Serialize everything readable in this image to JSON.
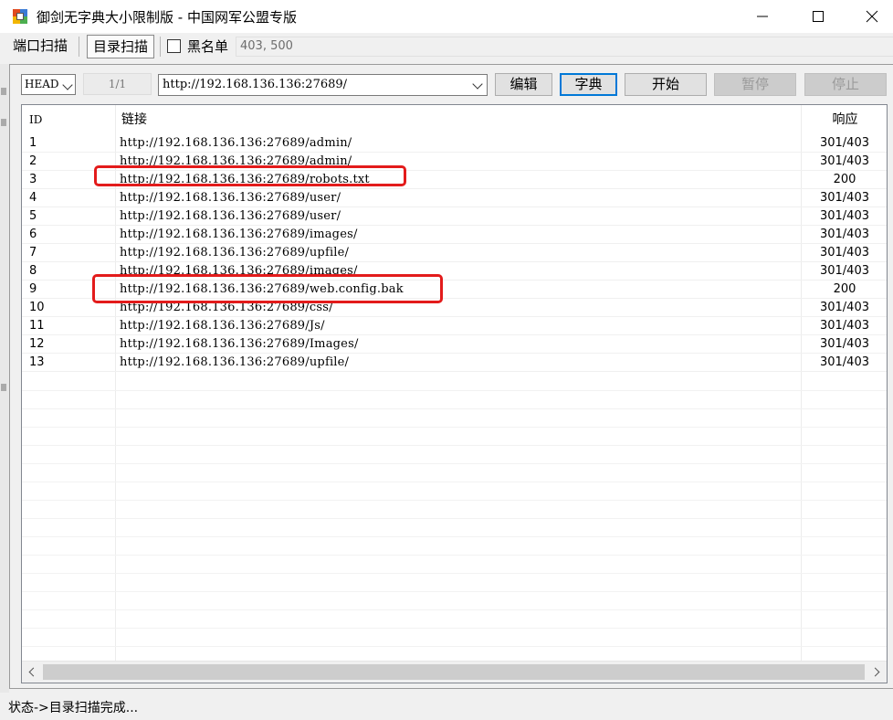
{
  "window": {
    "title": "御剑无字典大小限制版 - 中国网军公盟专版"
  },
  "tabs": {
    "port_scan": "端口扫描",
    "dir_scan": "目录扫描",
    "blacklist_label": "黑名单",
    "blacklist_checked": false,
    "filter_codes": "403, 500"
  },
  "controls": {
    "method": "HEAD",
    "counter": "1/1",
    "url": "http://192.168.136.136:27689/",
    "edit_button": "编辑",
    "dict_button": "字典",
    "start_button": "开始",
    "pause_button": "暂停",
    "stop_button": "停止"
  },
  "results": {
    "columns": [
      "ID",
      "链接",
      "响应"
    ],
    "rows": [
      {
        "id": "1",
        "link": "http://192.168.136.136:27689/admin/",
        "response": "301/403"
      },
      {
        "id": "2",
        "link": "http://192.168.136.136:27689/admin/",
        "response": "301/403"
      },
      {
        "id": "3",
        "link": "http://192.168.136.136:27689/robots.txt",
        "response": "200"
      },
      {
        "id": "4",
        "link": "http://192.168.136.136:27689/user/",
        "response": "301/403"
      },
      {
        "id": "5",
        "link": "http://192.168.136.136:27689/user/",
        "response": "301/403"
      },
      {
        "id": "6",
        "link": "http://192.168.136.136:27689/images/",
        "response": "301/403"
      },
      {
        "id": "7",
        "link": "http://192.168.136.136:27689/upfile/",
        "response": "301/403"
      },
      {
        "id": "8",
        "link": "http://192.168.136.136:27689/images/",
        "response": "301/403"
      },
      {
        "id": "9",
        "link": "http://192.168.136.136:27689/web.config.bak",
        "response": "200"
      },
      {
        "id": "10",
        "link": "http://192.168.136.136:27689/css/",
        "response": "301/403"
      },
      {
        "id": "11",
        "link": "http://192.168.136.136:27689/Js/",
        "response": "301/403"
      },
      {
        "id": "12",
        "link": "http://192.168.136.136:27689/Images/",
        "response": "301/403"
      },
      {
        "id": "13",
        "link": "http://192.168.136.136:27689/upfile/",
        "response": "301/403"
      }
    ]
  },
  "annotations": {
    "highlight_color": "#e31b1b",
    "highlighted_row_ids": [
      "3",
      "9"
    ]
  },
  "status": {
    "text": "状态->目录扫描完成..."
  }
}
